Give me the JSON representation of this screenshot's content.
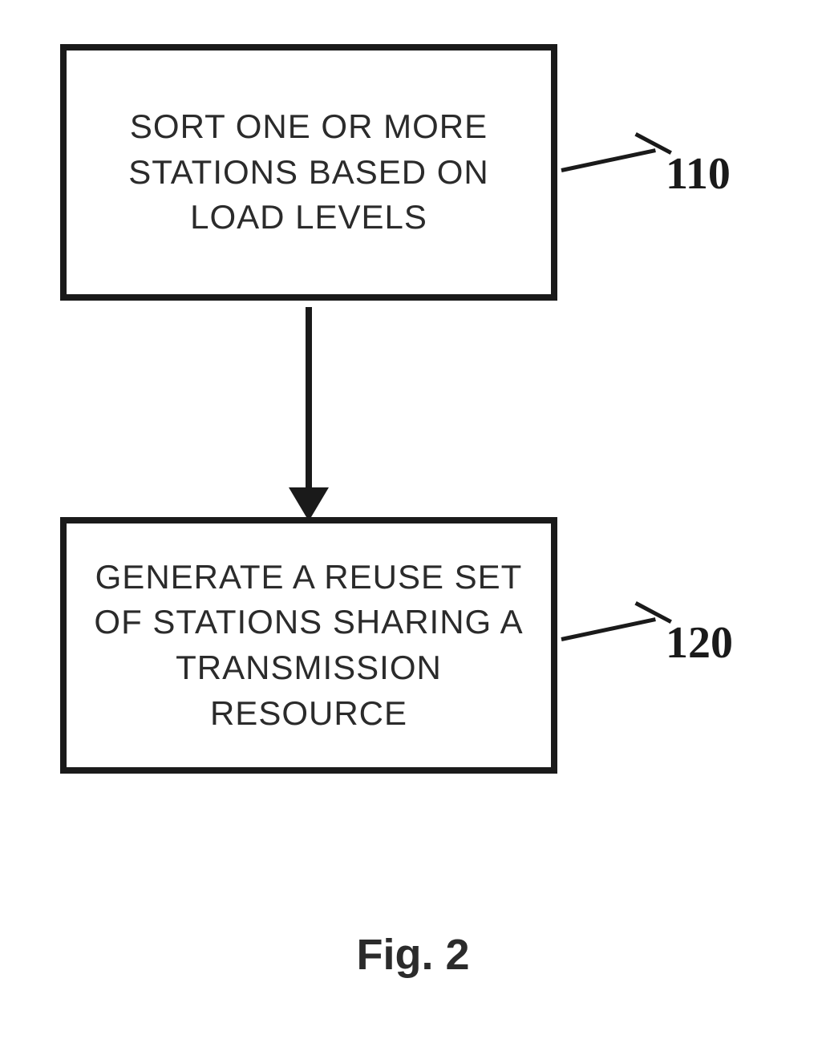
{
  "flow": {
    "steps": [
      {
        "id": "110",
        "text": "SORT ONE OR MORE STATIONS BASED ON LOAD LEVELS",
        "ref": "110"
      },
      {
        "id": "120",
        "text": "GENERATE A REUSE SET OF STATIONS SHARING A TRANSMISSION RESOURCE",
        "ref": "120"
      }
    ],
    "arrows": [
      {
        "from": "110",
        "to": "120"
      }
    ]
  },
  "caption": "Fig. 2"
}
